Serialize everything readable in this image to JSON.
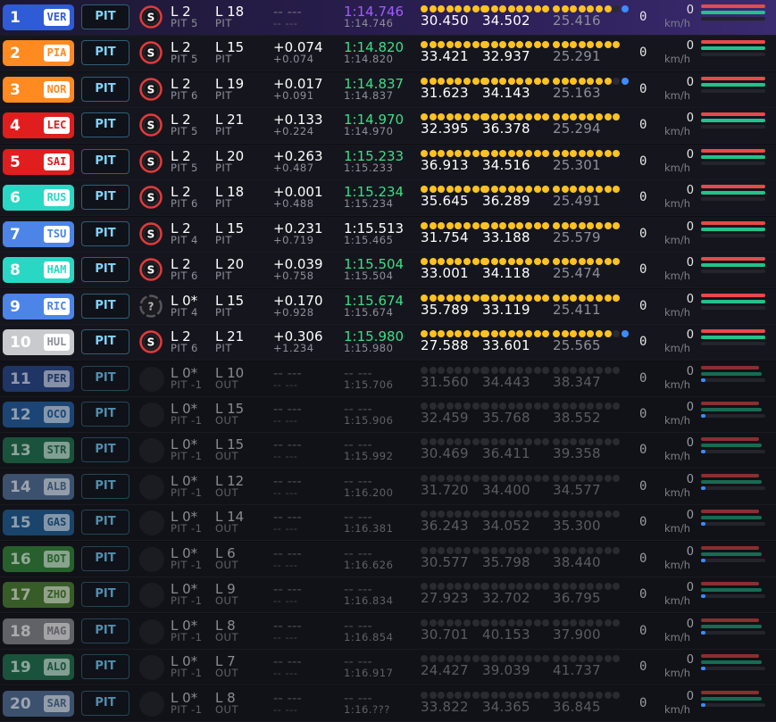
{
  "colors": {
    "gold_dot": "#ffc21f",
    "blue_dot": "#3d8bff",
    "dim_dot": "#2a2b31",
    "fastest_purple": "#a35cff",
    "personal_green": "#3dde86",
    "throttle_red": "#e64a4a",
    "brake_green": "#23c28a"
  },
  "pit_label": "PIT",
  "kmh_label": "km/h",
  "drivers": [
    {
      "pos": "1",
      "code": "VER",
      "team_color": "#2f5bd6",
      "code_color": "#2f5bd6",
      "tyre": "S",
      "lap": "L 2",
      "pit": "PIT 5",
      "lapno": "L 18",
      "status": "PIT",
      "gap": "-- ---",
      "gap_sub": "-- ---",
      "lap_time": "1:14.746",
      "lap_time_class": "purple",
      "best": "1:14.746",
      "s1": "30.450",
      "s2": "34.502",
      "s3": "25.416",
      "dots": [
        8,
        8,
        7
      ],
      "blue_last": true,
      "gear": "0",
      "speed": "0",
      "state": "first",
      "throttle": 1,
      "brake": 1
    },
    {
      "pos": "2",
      "code": "PIA",
      "team_color": "#ff8a1f",
      "code_color": "#ff8a1f",
      "tyre": "S",
      "lap": "L 2",
      "pit": "PIT 5",
      "lapno": "L 15",
      "status": "PIT",
      "gap": "+0.074",
      "gap_sub": "+0.074",
      "lap_time": "1:14.820",
      "lap_time_class": "green",
      "best": "1:14.820",
      "s1": "33.421",
      "s2": "32.937",
      "s3": "25.291",
      "dots": [
        8,
        8,
        8
      ],
      "blue_last": false,
      "gear": "0",
      "speed": "0",
      "state": "active",
      "throttle": 1,
      "brake": 1
    },
    {
      "pos": "3",
      "code": "NOR",
      "team_color": "#ff8a1f",
      "code_color": "#ff8a1f",
      "tyre": "S",
      "lap": "L 2",
      "pit": "PIT 6",
      "lapno": "L 19",
      "status": "PIT",
      "gap": "+0.017",
      "gap_sub": "+0.091",
      "lap_time": "1:14.837",
      "lap_time_class": "green",
      "best": "1:14.837",
      "s1": "31.623",
      "s2": "34.143",
      "s3": "25.163",
      "dots": [
        8,
        8,
        7
      ],
      "blue_last": true,
      "gear": "0",
      "speed": "0",
      "state": "active",
      "throttle": 1,
      "brake": 1
    },
    {
      "pos": "4",
      "code": "LEC",
      "team_color": "#e01e1e",
      "code_color": "#e01e1e",
      "tyre": "S",
      "lap": "L 2",
      "pit": "PIT 5",
      "lapno": "L 21",
      "status": "PIT",
      "gap": "+0.133",
      "gap_sub": "+0.224",
      "lap_time": "1:14.970",
      "lap_time_class": "green",
      "best": "1:14.970",
      "s1": "32.395",
      "s2": "36.378",
      "s3": "25.294",
      "dots": [
        8,
        8,
        8
      ],
      "blue_last": false,
      "gear": "0",
      "speed": "0",
      "state": "active",
      "throttle": 1,
      "brake": 1
    },
    {
      "pos": "5",
      "code": "SAI",
      "team_color": "#e01e1e",
      "code_color": "#e01e1e",
      "tyre": "S",
      "lap": "L 2",
      "pit": "PIT 5",
      "lapno": "L 20",
      "status": "PIT",
      "gap": "+0.263",
      "gap_sub": "+0.487",
      "lap_time": "1:15.233",
      "lap_time_class": "green",
      "best": "1:15.233",
      "s1": "36.913",
      "s2": "34.516",
      "s3": "25.301",
      "dots": [
        8,
        8,
        8
      ],
      "blue_last": false,
      "gear": "0",
      "speed": "0",
      "state": "active",
      "throttle": 1,
      "brake": 1
    },
    {
      "pos": "6",
      "code": "RUS",
      "team_color": "#29d8c4",
      "code_color": "#29d8c4",
      "tyre": "S",
      "lap": "L 2",
      "pit": "PIT 6",
      "lapno": "L 18",
      "status": "PIT",
      "gap": "+0.001",
      "gap_sub": "+0.488",
      "lap_time": "1:15.234",
      "lap_time_class": "green",
      "best": "1:15.234",
      "s1": "35.645",
      "s2": "36.289",
      "s3": "25.491",
      "dots": [
        8,
        8,
        8
      ],
      "blue_last": false,
      "gear": "0",
      "speed": "0",
      "state": "active",
      "throttle": 1,
      "brake": 1
    },
    {
      "pos": "7",
      "code": "TSU",
      "team_color": "#4c84e8",
      "code_color": "#4c84e8",
      "tyre": "S",
      "lap": "L 2",
      "pit": "PIT 4",
      "lapno": "L 15",
      "status": "PIT",
      "gap": "+0.231",
      "gap_sub": "+0.719",
      "lap_time": "1:15.513",
      "lap_time_class": "white",
      "best": "1:15.465",
      "s1": "31.754",
      "s2": "33.188",
      "s3": "25.579",
      "dots": [
        8,
        8,
        8
      ],
      "blue_last": false,
      "gear": "0",
      "speed": "0",
      "state": "active",
      "throttle": 1,
      "brake": 1
    },
    {
      "pos": "8",
      "code": "HAM",
      "team_color": "#29d8c4",
      "code_color": "#29d8c4",
      "tyre": "S",
      "lap": "L 2",
      "pit": "PIT 6",
      "lapno": "L 20",
      "status": "PIT",
      "gap": "+0.039",
      "gap_sub": "+0.758",
      "lap_time": "1:15.504",
      "lap_time_class": "green",
      "best": "1:15.504",
      "s1": "33.001",
      "s2": "34.118",
      "s3": "25.474",
      "dots": [
        8,
        8,
        8
      ],
      "blue_last": false,
      "gear": "0",
      "speed": "0",
      "state": "active",
      "throttle": 1,
      "brake": 1
    },
    {
      "pos": "9",
      "code": "RIC",
      "team_color": "#4c84e8",
      "code_color": "#4c84e8",
      "tyre": "?",
      "lap": "L 0*",
      "pit": "PIT 4",
      "lapno": "L 15",
      "status": "PIT",
      "gap": "+0.170",
      "gap_sub": "+0.928",
      "lap_time": "1:15.674",
      "lap_time_class": "green",
      "best": "1:15.674",
      "s1": "35.789",
      "s2": "33.119",
      "s3": "25.411",
      "dots": [
        8,
        8,
        8
      ],
      "blue_last": false,
      "gear": "0",
      "speed": "0",
      "state": "active",
      "throttle": 1,
      "brake": 1
    },
    {
      "pos": "10",
      "code": "HUL",
      "team_color": "#c9cacd",
      "code_color": "#8f9095",
      "tyre": "S",
      "lap": "L 2",
      "pit": "PIT 6",
      "lapno": "L 21",
      "status": "PIT",
      "gap": "+0.306",
      "gap_sub": "+1.234",
      "lap_time": "1:15.980",
      "lap_time_class": "green",
      "best": "1:15.980",
      "s1": "27.588",
      "s2": "33.601",
      "s3": "25.565",
      "dots": [
        8,
        8,
        7
      ],
      "blue_last": true,
      "gear": "0",
      "speed": "0",
      "state": "active",
      "throttle": 1,
      "brake": 1
    },
    {
      "pos": "11",
      "code": "PER",
      "team_color": "#223c73",
      "code_color": "#223c73",
      "tyre": "",
      "lap": "L 0*",
      "pit": "PIT -1",
      "lapno": "L 10",
      "status": "OUT",
      "gap": "-- ---",
      "gap_sub": "-- ---",
      "lap_time": "-- ---",
      "lap_time_class": "dim",
      "best": "1:15.706",
      "s1": "31.560",
      "s2": "34.443",
      "s3": "38.347",
      "dots": [
        8,
        8,
        8
      ],
      "blue_last": false,
      "gear": "0",
      "speed": "0",
      "state": "dim",
      "throttle": 0.9,
      "brake": 0.95
    },
    {
      "pos": "12",
      "code": "OCO",
      "team_color": "#1f4f86",
      "code_color": "#1f4f86",
      "tyre": "",
      "lap": "L 0*",
      "pit": "PIT -1",
      "lapno": "L 15",
      "status": "OUT",
      "gap": "-- ---",
      "gap_sub": "-- ---",
      "lap_time": "-- ---",
      "lap_time_class": "dim",
      "best": "1:15.906",
      "s1": "32.459",
      "s2": "35.768",
      "s3": "38.552",
      "dots": [
        8,
        8,
        8
      ],
      "blue_last": false,
      "gear": "0",
      "speed": "0",
      "state": "dim",
      "throttle": 0.9,
      "brake": 0.95
    },
    {
      "pos": "13",
      "code": "STR",
      "team_color": "#1c5f42",
      "code_color": "#1c5f42",
      "tyre": "",
      "lap": "L 0*",
      "pit": "PIT -1",
      "lapno": "L 15",
      "status": "OUT",
      "gap": "-- ---",
      "gap_sub": "-- ---",
      "lap_time": "-- ---",
      "lap_time_class": "dim",
      "best": "1:15.992",
      "s1": "30.469",
      "s2": "36.411",
      "s3": "39.358",
      "dots": [
        8,
        8,
        8
      ],
      "blue_last": false,
      "gear": "0",
      "speed": "0",
      "state": "dim",
      "throttle": 0.9,
      "brake": 0.95
    },
    {
      "pos": "14",
      "code": "ALB",
      "team_color": "#445d7d",
      "code_color": "#445d7d",
      "tyre": "",
      "lap": "L 0*",
      "pit": "PIT -1",
      "lapno": "L 12",
      "status": "OUT",
      "gap": "-- ---",
      "gap_sub": "-- ---",
      "lap_time": "-- ---",
      "lap_time_class": "dim",
      "best": "1:16.200",
      "s1": "31.720",
      "s2": "34.400",
      "s3": "34.577",
      "dots": [
        8,
        8,
        8
      ],
      "blue_last": false,
      "gear": "0",
      "speed": "0",
      "state": "dim",
      "throttle": 0.9,
      "brake": 0.95
    },
    {
      "pos": "15",
      "code": "GAS",
      "team_color": "#1b4d7a",
      "code_color": "#1b4d7a",
      "tyre": "",
      "lap": "L 0*",
      "pit": "PIT -1",
      "lapno": "L 14",
      "status": "OUT",
      "gap": "-- ---",
      "gap_sub": "-- ---",
      "lap_time": "-- ---",
      "lap_time_class": "dim",
      "best": "1:16.381",
      "s1": "36.243",
      "s2": "34.052",
      "s3": "35.300",
      "dots": [
        8,
        8,
        8
      ],
      "blue_last": false,
      "gear": "0",
      "speed": "0",
      "state": "dim",
      "throttle": 0.9,
      "brake": 0.95
    },
    {
      "pos": "16",
      "code": "BOT",
      "team_color": "#2c6e31",
      "code_color": "#2c6e31",
      "tyre": "",
      "lap": "L 0*",
      "pit": "PIT -1",
      "lapno": "L 6",
      "status": "OUT",
      "gap": "-- ---",
      "gap_sub": "-- ---",
      "lap_time": "-- ---",
      "lap_time_class": "dim",
      "best": "1:16.626",
      "s1": "30.577",
      "s2": "35.798",
      "s3": "38.440",
      "dots": [
        8,
        8,
        8
      ],
      "blue_last": false,
      "gear": "0",
      "speed": "0",
      "state": "dim",
      "throttle": 0.9,
      "brake": 0.95
    },
    {
      "pos": "17",
      "code": "ZHO",
      "team_color": "#3f6a2b",
      "code_color": "#3f6a2b",
      "tyre": "",
      "lap": "L 0*",
      "pit": "PIT -1",
      "lapno": "L 9",
      "status": "OUT",
      "gap": "-- ---",
      "gap_sub": "-- ---",
      "lap_time": "-- ---",
      "lap_time_class": "dim",
      "best": "1:16.834",
      "s1": "27.923",
      "s2": "32.702",
      "s3": "36.795",
      "dots": [
        8,
        8,
        8
      ],
      "blue_last": false,
      "gear": "0",
      "speed": "0",
      "state": "dim",
      "throttle": 0.9,
      "brake": 0.95
    },
    {
      "pos": "18",
      "code": "MAG",
      "team_color": "#6f7075",
      "code_color": "#6f7075",
      "tyre": "",
      "lap": "L 0*",
      "pit": "PIT -1",
      "lapno": "L 8",
      "status": "OUT",
      "gap": "-- ---",
      "gap_sub": "-- ---",
      "lap_time": "-- ---",
      "lap_time_class": "dim",
      "best": "1:16.854",
      "s1": "30.701",
      "s2": "40.153",
      "s3": "37.900",
      "dots": [
        8,
        8,
        8
      ],
      "blue_last": false,
      "gear": "0",
      "speed": "0",
      "state": "dim",
      "throttle": 0.9,
      "brake": 0.95
    },
    {
      "pos": "19",
      "code": "ALO",
      "team_color": "#1c5f42",
      "code_color": "#1c5f42",
      "tyre": "",
      "lap": "L 0*",
      "pit": "PIT -1",
      "lapno": "L 7",
      "status": "OUT",
      "gap": "-- ---",
      "gap_sub": "-- ---",
      "lap_time": "-- ---",
      "lap_time_class": "dim",
      "best": "1:16.917",
      "s1": "24.427",
      "s2": "39.039",
      "s3": "41.737",
      "dots": [
        8,
        8,
        8
      ],
      "blue_last": false,
      "gear": "0",
      "speed": "0",
      "state": "dim",
      "throttle": 0.9,
      "brake": 0.95
    },
    {
      "pos": "20",
      "code": "SAR",
      "team_color": "#445d7d",
      "code_color": "#445d7d",
      "tyre": "",
      "lap": "L 0*",
      "pit": "PIT -1",
      "lapno": "L 8",
      "status": "OUT",
      "gap": "-- ---",
      "gap_sub": "-- ---",
      "lap_time": "-- ---",
      "lap_time_class": "dim",
      "best": "1:16.???",
      "s1": "33.822",
      "s2": "34.365",
      "s3": "36.845",
      "dots": [
        8,
        8,
        8
      ],
      "blue_last": false,
      "gear": "0",
      "speed": "0",
      "state": "dim",
      "throttle": 0.9,
      "brake": 0.95
    }
  ]
}
